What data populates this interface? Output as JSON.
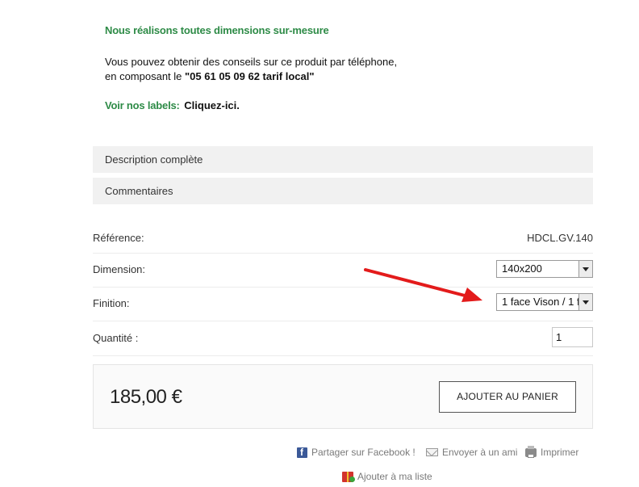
{
  "info": {
    "custom_sizes": "Nous réalisons toutes dimensions sur-mesure",
    "phone_line1": "Vous pouvez obtenir des conseils sur ce produit par téléphone,",
    "phone_line2_prefix": "en composant le ",
    "phone_number": "\"05 61 05 09 62 tarif local\"",
    "labels_title": "Voir nos labels:",
    "labels_link": "Cliquez-ici."
  },
  "tabs": [
    {
      "label": "Description complète"
    },
    {
      "label": "Commentaires"
    }
  ],
  "product": {
    "reference_label": "Référence:",
    "reference_value": "HDCL.GV.140",
    "dimension_label": "Dimension:",
    "dimension_value": "140x200",
    "finition_label": "Finition:",
    "finition_value": "1 face Vison / 1 f",
    "quantity_label": "Quantité :",
    "quantity_value": "1"
  },
  "purchase": {
    "price": "185,00 €",
    "cart_button": "AJOUTER AU PANIER"
  },
  "share": {
    "facebook": "Partager sur Facebook !",
    "email": "Envoyer à un ami",
    "print": "Imprimer",
    "wishlist": "Ajouter à ma liste"
  },
  "annotation": {
    "arrow_color": "#e31b1b"
  }
}
